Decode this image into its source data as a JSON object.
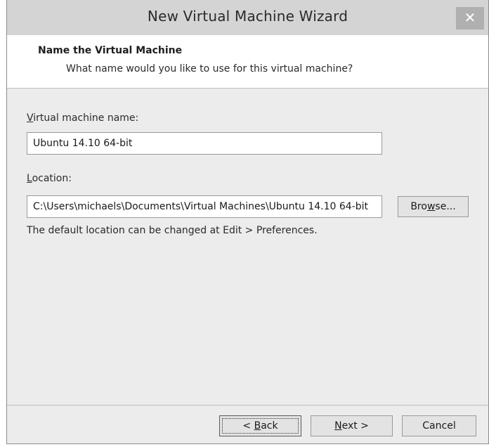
{
  "window": {
    "title": "New Virtual Machine Wizard",
    "close_glyph": "✕"
  },
  "header": {
    "title": "Name the Virtual Machine",
    "subtitle": "What name would you like to use for this virtual machine?"
  },
  "name_field": {
    "label_accel": "V",
    "label_rest": "irtual machine name:",
    "value": "Ubuntu 14.10 64-bit"
  },
  "location_field": {
    "label_accel": "L",
    "label_rest": "ocation:",
    "value": "C:\\Users\\michaels\\Documents\\Virtual Machines\\Ubuntu 14.10 64-bit"
  },
  "browse_button": {
    "accel": "w",
    "before": "Bro",
    "after": "se..."
  },
  "info_text": "The default location can be changed at Edit > Preferences.",
  "footer": {
    "back": {
      "before": "< ",
      "accel": "B",
      "after": "ack"
    },
    "next": {
      "before": "",
      "accel": "N",
      "after": "ext >"
    },
    "cancel": "Cancel"
  }
}
